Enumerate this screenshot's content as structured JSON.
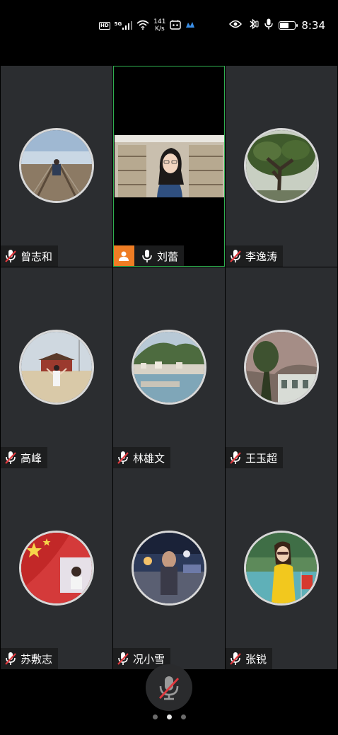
{
  "status_bar": {
    "hd_badge": "HD",
    "network_type": "5G",
    "net_speed_value": "141",
    "net_speed_unit": "K/s",
    "time": "8:34",
    "battery_level": 0.6,
    "icons": [
      "hd-icon",
      "signal-icon",
      "wifi-icon",
      "notification-icon",
      "app-icon",
      "eye-icon",
      "bluetooth-icon",
      "mic-icon",
      "battery-icon"
    ]
  },
  "participants": [
    {
      "name": "曾志和",
      "muted": true,
      "avatar": "railway-photo"
    },
    {
      "name": "刘蕾",
      "muted": false,
      "host": true,
      "video_on": true,
      "active_speaker": true
    },
    {
      "name": "李逸涛",
      "muted": true,
      "avatar": "tree-photo"
    },
    {
      "name": "高峰",
      "muted": true,
      "avatar": "gate-photo"
    },
    {
      "name": "林雄文",
      "muted": true,
      "avatar": "harbor-photo"
    },
    {
      "name": "王玉超",
      "muted": true,
      "avatar": "building-photo"
    },
    {
      "name": "苏敷志",
      "muted": true,
      "avatar": "flag-photo"
    },
    {
      "name": "况小雪",
      "muted": true,
      "avatar": "night-street-photo"
    },
    {
      "name": "张锐",
      "muted": true,
      "avatar": "lake-photo"
    }
  ],
  "controls": {
    "self_mic_muted": true
  },
  "pagination": {
    "page_count": 3,
    "current_page": 2
  },
  "colors": {
    "active_border": "#2fae4f",
    "host_badge": "#ef7d24",
    "muted_slash": "#e0393e",
    "tile_bg": "#2b2d30"
  }
}
